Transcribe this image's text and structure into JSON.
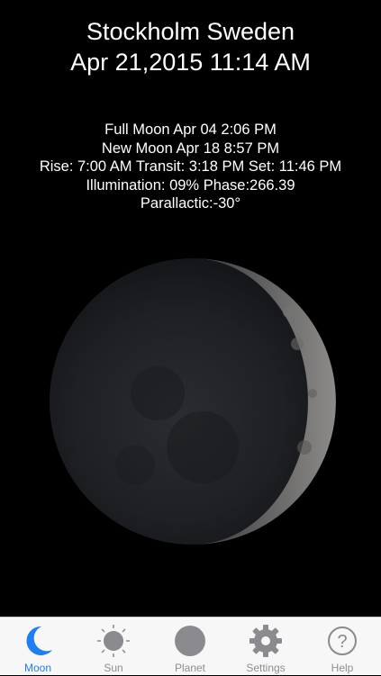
{
  "header": {
    "location": "Stockholm Sweden",
    "datetime": "Apr 21,2015 11:14 AM"
  },
  "info": {
    "full_moon": "Full Moon Apr 04 2:06 PM",
    "new_moon": "New Moon Apr 18 8:57 PM",
    "rise_transit_set": "Rise: 7:00 AM Transit: 3:18 PM Set: 11:46 PM",
    "illumination_phase": "Illumination: 09% Phase:266.39",
    "parallactic": "Parallactic:-30°"
  },
  "moon": {
    "illumination_fraction": 0.09
  },
  "tabs": [
    {
      "label": "Moon",
      "icon": "moon-icon",
      "active": true
    },
    {
      "label": "Sun",
      "icon": "sun-icon",
      "active": false
    },
    {
      "label": "Planet",
      "icon": "planet-icon",
      "active": false
    },
    {
      "label": "Settings",
      "icon": "gear-icon",
      "active": false
    },
    {
      "label": "Help",
      "icon": "question-icon",
      "active": false
    }
  ],
  "colors": {
    "background": "#000000",
    "text": "#ffffff",
    "tab_active": "#1e7ef5",
    "tab_inactive": "#8e8e93",
    "tabbar_bg": "#f7f7f7"
  }
}
